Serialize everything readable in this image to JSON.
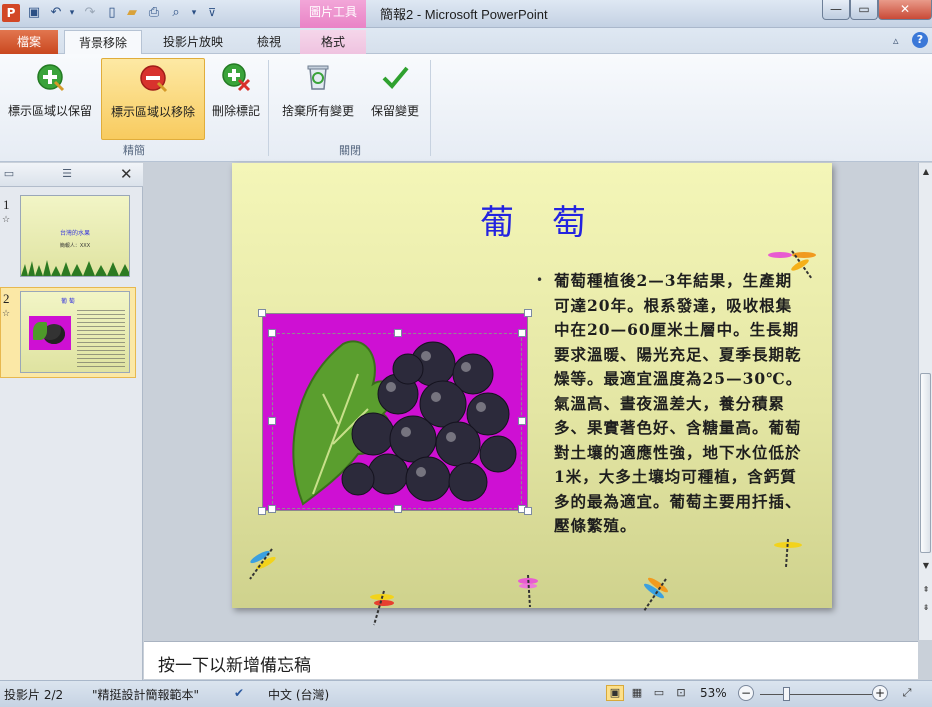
{
  "window": {
    "app_icon": "P",
    "title": "簡報2 - Microsoft PowerPoint",
    "context_tab_header": "圖片工具",
    "controls": [
      "minimize",
      "maximize",
      "close"
    ]
  },
  "quick_access": {
    "icons": [
      "save-icon",
      "undo-icon",
      "redo-icon",
      "new-icon",
      "open-icon",
      "print-icon",
      "print-preview-icon",
      "customize-icon"
    ]
  },
  "tabs": [
    {
      "label": "檔案"
    },
    {
      "label": "背景移除"
    },
    {
      "label": "投影片放映"
    },
    {
      "label": "檢視"
    },
    {
      "label": "格式"
    }
  ],
  "ribbon": {
    "groups": [
      {
        "label": "精簡"
      },
      {
        "label": "關閉"
      }
    ],
    "buttons": [
      {
        "label": "標示區域以保留"
      },
      {
        "label": "標示區域以移除"
      },
      {
        "label": "刪除標記"
      },
      {
        "label": "捨棄所有變更"
      },
      {
        "label": "保留變更"
      }
    ]
  },
  "thumbnails": [
    {
      "number": "1",
      "mark": "☆",
      "title": "台灣的水果",
      "subtitle": "簡報人：XXX"
    },
    {
      "number": "2",
      "mark": "☆",
      "title": "葡 萄"
    }
  ],
  "slide": {
    "title": "葡萄",
    "bullet": "•",
    "body": "葡萄種植後2—3年結果，生產期可達20年。根系發達，吸收根集中在20—60厘米土層中。生長期要求溫暖、陽光充足、夏季長期乾燥等。最適宜溫度為25—30℃。氣溫高、晝夜溫差大，養分積累多、果實著色好、含糖量高。葡萄對土壤的適應性強，地下水位低於1米，大多土壤均可種植，含鈣質多的最為適宜。葡萄主要用扦插、壓條繁殖。"
  },
  "notes": {
    "placeholder": "按一下以新增備忘稿"
  },
  "statusbar": {
    "slide_indicator": "投影片 2/2",
    "theme": "\"精挺設計簡報範本\"",
    "language": "中文 (台灣)",
    "zoom": "53%"
  },
  "colors": {
    "accent_file_tab": "#c9471f",
    "context_tab": "#e983c6",
    "title_text": "#2323e0",
    "picture_background": "#ce10d3"
  }
}
